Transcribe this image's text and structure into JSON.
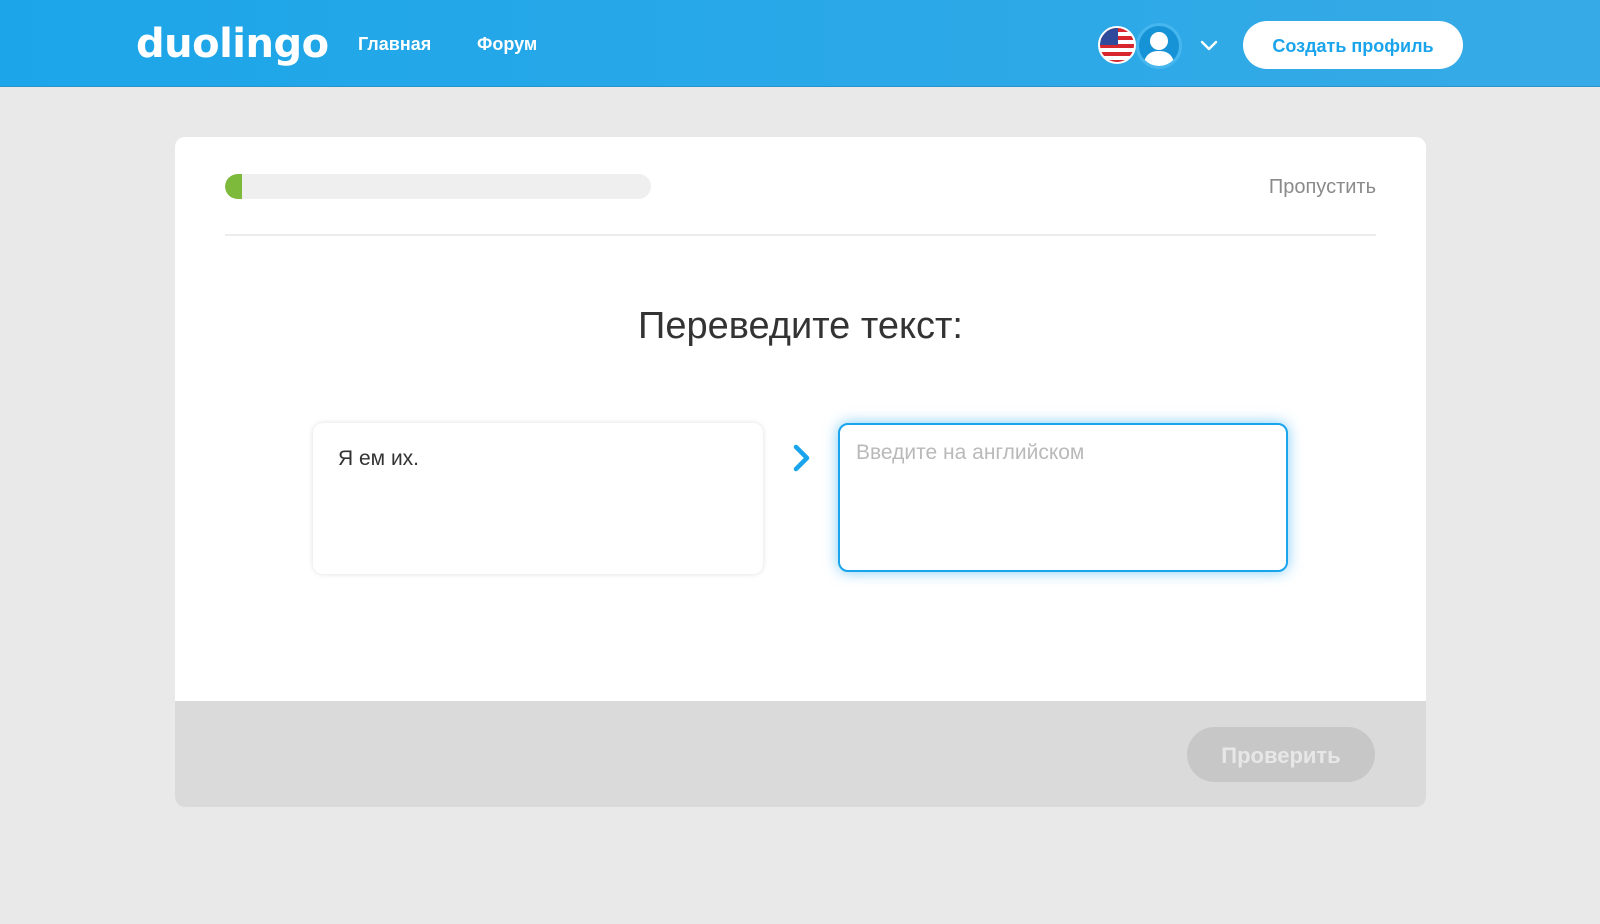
{
  "header": {
    "logo_text": "duolingo",
    "nav": {
      "home_label": "Главная",
      "forum_label": "Форум"
    },
    "flag_icon": "us-flag-icon",
    "avatar_icon": "user-avatar-icon",
    "dropdown_icon": "chevron-down-icon",
    "create_profile_label": "Создать профиль",
    "accent_color": "#1ca6e9"
  },
  "lesson": {
    "progress_fraction": 0.04,
    "progress_color": "#7dba3c",
    "skip_label": "Пропустить",
    "prompt_title": "Переведите текст:",
    "source_text": "Я ем их.",
    "arrow_icon": "chevron-right-icon",
    "answer": {
      "value": "",
      "placeholder": "Введите на английском"
    },
    "check_label": "Проверить",
    "check_disabled": true
  }
}
